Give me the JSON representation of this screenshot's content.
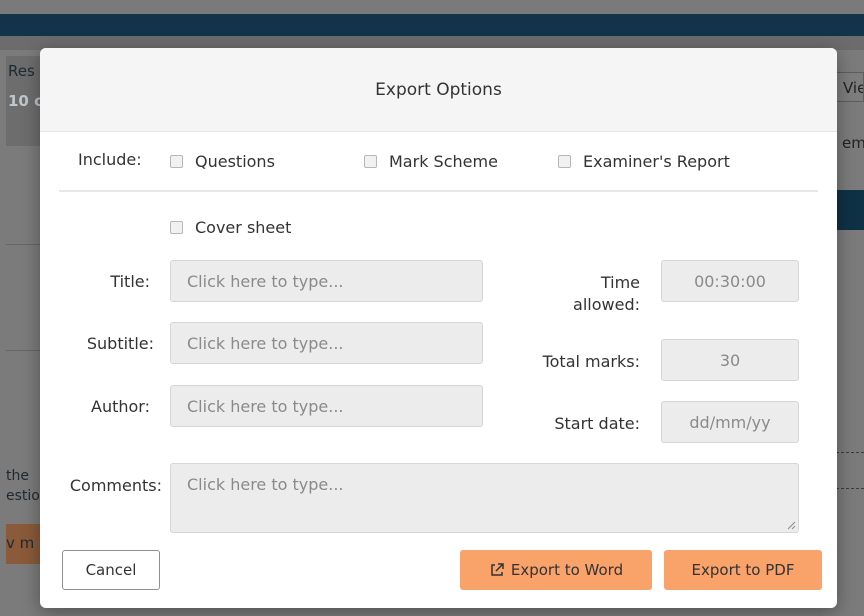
{
  "background": {
    "left_title_fragment": "Res",
    "left_subtitle_fragment": "10 c",
    "right_button_fragment": "Vie",
    "right_button2_fragment": "em",
    "left_text_line1": "the",
    "left_text_line2": "estio",
    "left_orange_fragment": "v m"
  },
  "modal": {
    "title": "Export Options",
    "include": {
      "label": "Include:",
      "options": [
        "Questions",
        "Mark Scheme",
        "Examiner's Report"
      ]
    },
    "cover_sheet_label": "Cover sheet",
    "title_field": {
      "label": "Title:",
      "placeholder": "Click here to type..."
    },
    "subtitle_field": {
      "label": "Subtitle:",
      "placeholder": "Click here to type..."
    },
    "author_field": {
      "label": "Author:",
      "placeholder": "Click here to type..."
    },
    "comments_field": {
      "label": "Comments:",
      "placeholder": "Click here to type..."
    },
    "time_allowed": {
      "label_line1": "Time",
      "label_line2": "allowed:",
      "value": "00:30:00"
    },
    "total_marks": {
      "label": "Total marks:",
      "value": "30"
    },
    "start_date": {
      "label": "Start date:",
      "placeholder": "dd/mm/yy"
    },
    "buttons": {
      "cancel": "Cancel",
      "export_word": "Export to Word",
      "export_pdf": "Export to PDF"
    }
  },
  "colors": {
    "accent": "#f9a26a",
    "topbar": "#12334a"
  }
}
